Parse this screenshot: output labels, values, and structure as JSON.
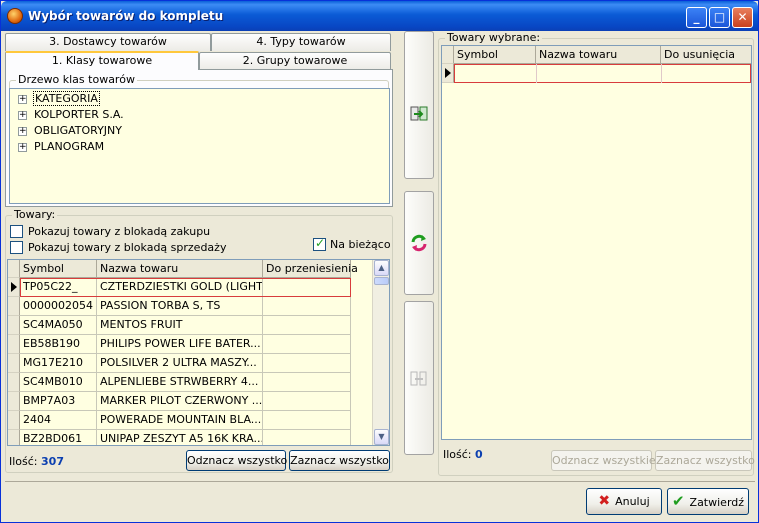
{
  "window": {
    "title": "Wybór towarów do kompletu",
    "controls": {
      "minimize": "_",
      "maximize": "□",
      "close": "✕"
    }
  },
  "tabs": {
    "row_top": [
      {
        "label": "3. Dostawcy towarów"
      },
      {
        "label": "4. Typy towarów"
      }
    ],
    "row_bottom": [
      {
        "label": "1. Klasy towarowe",
        "active": true
      },
      {
        "label": "2. Grupy towarowe"
      }
    ]
  },
  "tree": {
    "title": "Drzewo klas towarów",
    "items": [
      {
        "label": "KATEGORIA",
        "selected": true
      },
      {
        "label": "KOLPORTER S.A."
      },
      {
        "label": "OBLIGATORYJNY"
      },
      {
        "label": "PLANOGRAM"
      }
    ]
  },
  "towary": {
    "title": "Towary:",
    "options": {
      "block_purchase": "Pokazuj towary z blokadą zakupu",
      "block_sale": "Pokazuj towary z blokadą sprzedaży",
      "current": "Na bieżąco"
    },
    "columns": [
      "Symbol",
      "Nazwa towaru",
      "Do przeniesienia"
    ],
    "rows": [
      [
        "TP05C22_",
        "CZTERDZIESTKI GOLD (LIGHT)",
        ""
      ],
      [
        "0000002054",
        "PASSION TORBA S, TS",
        ""
      ],
      [
        "SC4MA050",
        "MENTOS FRUIT",
        ""
      ],
      [
        "EB58B190",
        "PHILIPS POWER LIFE BATER...",
        ""
      ],
      [
        "MG17E210",
        "POLSILVER 2 ULTRA MASZY...",
        ""
      ],
      [
        "SC4MB010",
        "ALPENLIEBE STRWBERRY 4...",
        ""
      ],
      [
        "BMP7A03",
        "MARKER PILOT CZERWONY ...",
        ""
      ],
      [
        "2404",
        "POWERADE MOUNTAIN BLA...",
        ""
      ],
      [
        "BZ2BD061",
        "UNIPAP ZESZYT A5 16K KRA...",
        ""
      ]
    ],
    "count_label": "Ilość:",
    "count_value": "307",
    "deselect_all": "Odznacz wszystko",
    "select_all": "Zaznacz wszystko"
  },
  "selected": {
    "title": "Towary wybrane:",
    "columns": [
      "Symbol",
      "Nazwa towaru",
      "Do usunięcia"
    ],
    "count_label": "Ilość:",
    "count_value": "0",
    "deselect_all": "Odznacz wszystkie",
    "select_all": "Zaznacz wszystko"
  },
  "footer": {
    "cancel": "Anuluj",
    "confirm": "Zatwierdź"
  },
  "colors": {
    "accent_count": "#0b3fb0",
    "grid_background": "#ffffe1",
    "selection_border": "#d83c3c"
  }
}
